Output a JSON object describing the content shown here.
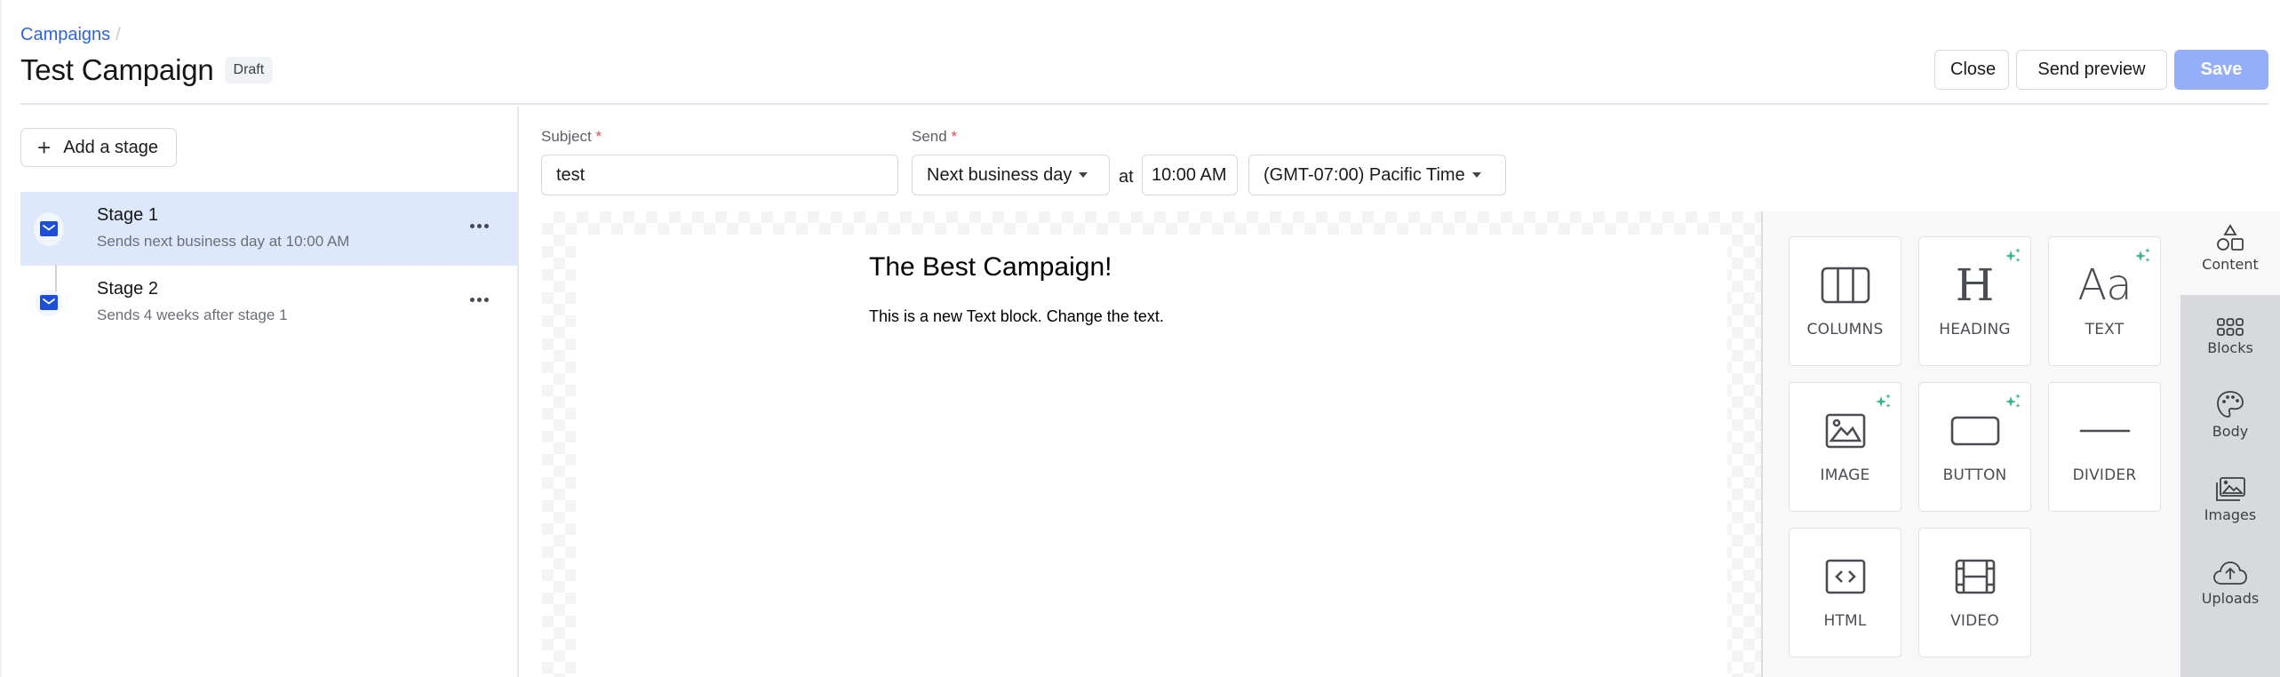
{
  "header": {
    "breadcrumb": {
      "parent": "Campaigns",
      "separator": "/"
    },
    "title": "Test Campaign",
    "status_badge": "Draft",
    "actions": {
      "close": "Close",
      "send_preview": "Send preview",
      "save": "Save"
    }
  },
  "stages": {
    "add_label": "Add a stage",
    "items": [
      {
        "name": "Stage 1",
        "description": "Sends next business day at 10:00 AM",
        "active": true
      },
      {
        "name": "Stage 2",
        "description": "Sends 4 weeks after stage 1",
        "active": false
      }
    ]
  },
  "editor": {
    "subject": {
      "label": "Subject",
      "required_mark": "*",
      "value": "test"
    },
    "send": {
      "label": "Send",
      "required_mark": "*",
      "schedule": "Next business day",
      "at_label": "at",
      "time": "10:00 AM",
      "timezone": "(GMT-07:00) Pacific Time"
    }
  },
  "email": {
    "heading": "The Best Campaign!",
    "text": "This is a new Text block. Change the text."
  },
  "tools": {
    "blocks": [
      {
        "label": "COLUMNS",
        "icon": "columns-icon",
        "ai": false
      },
      {
        "label": "HEADING",
        "icon": "heading-icon",
        "ai": true
      },
      {
        "label": "TEXT",
        "icon": "text-icon",
        "ai": true
      },
      {
        "label": "IMAGE",
        "icon": "image-icon",
        "ai": true
      },
      {
        "label": "BUTTON",
        "icon": "button-icon",
        "ai": true
      },
      {
        "label": "DIVIDER",
        "icon": "divider-icon",
        "ai": false
      },
      {
        "label": "HTML",
        "icon": "html-icon",
        "ai": false
      },
      {
        "label": "VIDEO",
        "icon": "video-icon",
        "ai": false
      }
    ],
    "heading_glyph": "H",
    "text_glyph": "Aa",
    "accent_color": "#3fb58a"
  },
  "rail": {
    "tabs": [
      {
        "label": "Content",
        "icon": "shapes-icon",
        "active": true
      },
      {
        "label": "Blocks",
        "icon": "blocks-grid-icon",
        "active": false
      },
      {
        "label": "Body",
        "icon": "palette-icon",
        "active": false
      },
      {
        "label": "Images",
        "icon": "images-icon",
        "active": false
      },
      {
        "label": "Uploads",
        "icon": "cloud-upload-icon",
        "active": false
      }
    ]
  },
  "colors": {
    "link": "#2f63e6",
    "primary_disabled": "#95aefa",
    "active_stage_bg": "#dde8fc",
    "envelope": "#1d4ed8",
    "required": "#e2474f"
  }
}
